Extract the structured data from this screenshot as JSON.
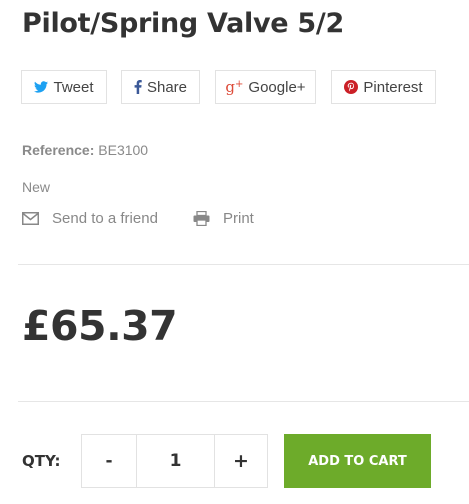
{
  "product": {
    "title": "Pilot/Spring Valve 5/2",
    "reference_label": "Reference:",
    "reference_value": "BE3100",
    "condition": "New",
    "price": "£65.37"
  },
  "social": {
    "tweet": "Tweet",
    "share": "Share",
    "google": "Google+",
    "pinterest": "Pinterest",
    "colors": {
      "twitter": "#1da1f2",
      "facebook": "#3b5998",
      "google": "#dd4b39",
      "pinterest": "#cb2027"
    }
  },
  "actions": {
    "send_to_friend": "Send to a friend",
    "print": "Print"
  },
  "cart": {
    "qty_label": "QTY:",
    "minus": "-",
    "quantity": "1",
    "plus": "+",
    "add_to_cart": "ADD TO CART",
    "accent": "#6dab2a"
  }
}
